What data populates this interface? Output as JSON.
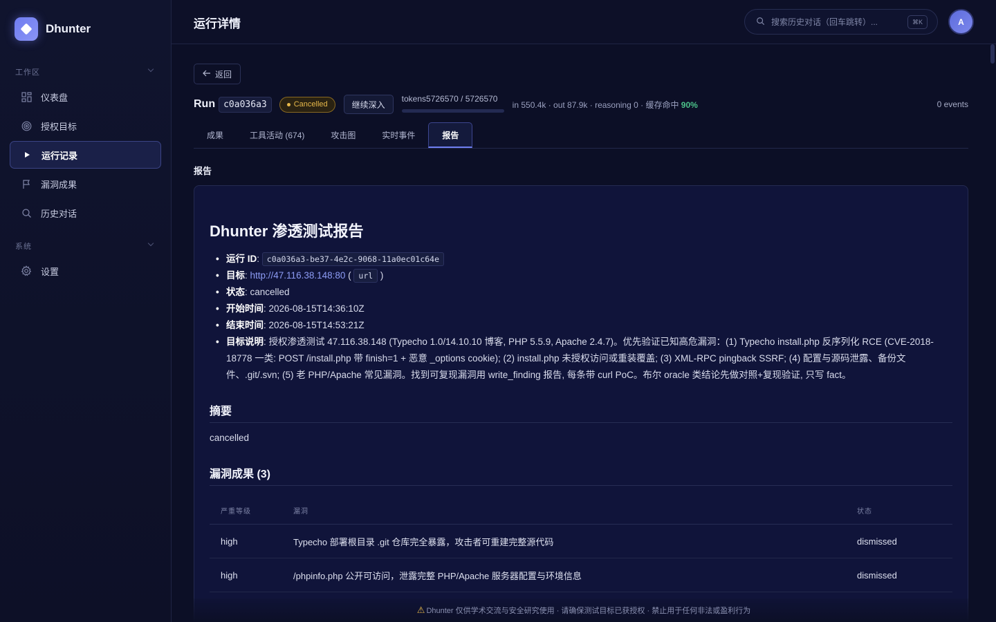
{
  "app": {
    "name": "Dhunter"
  },
  "sidebar": {
    "workspace_label": "工作区",
    "system_label": "系统",
    "items": [
      {
        "label": "仪表盘",
        "icon": "dashboard-icon"
      },
      {
        "label": "授权目标",
        "icon": "target-icon"
      },
      {
        "label": "运行记录",
        "icon": "play-icon",
        "active": true
      },
      {
        "label": "漏洞成果",
        "icon": "flag-icon"
      },
      {
        "label": "历史对话",
        "icon": "search-icon"
      }
    ],
    "system_items": [
      {
        "label": "设置",
        "icon": "gear-icon"
      }
    ]
  },
  "header": {
    "title": "运行详情",
    "search_placeholder": "搜索历史对话（回车跳转）...",
    "shortcut": "⌘K",
    "avatar_initial": "A"
  },
  "run": {
    "back_label": "返回",
    "run_label": "Run",
    "run_id_short": "c0a036a3",
    "status": "Cancelled",
    "deep_dive_label": "继续深入",
    "tokens_text": "tokens5726570 / 5726570",
    "tokens_fraction": 1.0,
    "usage_prefix": "in 550.4k · out 87.9k · reasoning 0 · 缓存命中",
    "cache_hit": "90%",
    "events": "0 events"
  },
  "tabs": [
    {
      "label": "成果"
    },
    {
      "label": "工具活动 (674)"
    },
    {
      "label": "攻击图"
    },
    {
      "label": "实时事件"
    },
    {
      "label": "报告",
      "active": true
    }
  ],
  "report": {
    "section_label": "报告",
    "title": "Dhunter 渗透测试报告",
    "meta": {
      "run_id_key": "运行 ID",
      "run_id": "c0a036a3-be37-4e2c-9068-11a0ec01c64e",
      "target_key": "目标",
      "target_url": "http://47.116.38.148:80",
      "target_type": "url",
      "status_key": "状态",
      "status": "cancelled",
      "start_key": "开始时间",
      "start": "2026-08-15T14:36:10Z",
      "end_key": "结束时间",
      "end": "2026-08-15T14:53:21Z",
      "desc_key": "目标说明",
      "desc": "授权渗透测试 47.116.38.148 (Typecho 1.0/14.10.10 博客, PHP 5.5.9, Apache 2.4.7)。优先验证已知高危漏洞：(1) Typecho install.php 反序列化 RCE (CVE-2018-18778 一类: POST /install.php 带 finish=1 + 恶意 _options cookie); (2) install.php 未授权访问或重装覆盖; (3) XML-RPC pingback SSRF; (4) 配置与源码泄露、备份文件、.git/.svn; (5) 老 PHP/Apache 常见漏洞。找到可复现漏洞用 write_finding 报告, 每条带 curl PoC。布尔 oracle 类结论先做对照+复现验证, 只写 fact。"
    },
    "summary_heading": "摘要",
    "summary": "cancelled",
    "findings_heading": "漏洞成果 (3)",
    "table": {
      "headers": [
        "严重等级",
        "漏洞",
        "状态"
      ],
      "rows": [
        {
          "severity": "high",
          "title": "Typecho 部署根目录 .git 仓库完全暴露，攻击者可重建完整源代码",
          "status": "dismissed"
        },
        {
          "severity": "high",
          "title": "/phpinfo.php 公开可访问，泄露完整 PHP/Apache 服务器配置与环境信息",
          "status": "dismissed"
        }
      ]
    }
  },
  "footer": {
    "notice": "Dhunter 仅供学术交流与安全研究使用 · 请确保测试目标已获授权 · 禁止用于任何非法或盈利行为"
  },
  "colors": {
    "accent": "#6f7ff0",
    "cancelled": "#e7b84a",
    "cache_hit": "#4cc38a"
  }
}
